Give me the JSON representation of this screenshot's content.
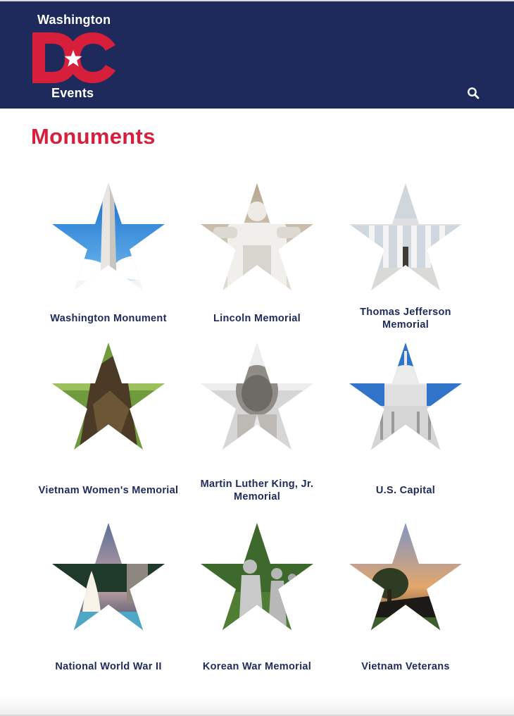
{
  "header": {
    "logo": {
      "top_text": "Washington",
      "mark_text": "DC",
      "bottom_text": "Events"
    },
    "search_icon": "search-icon"
  },
  "page": {
    "title": "Monuments"
  },
  "monuments": [
    {
      "label": "Washington Monument",
      "photo": "obelisk against blue sky"
    },
    {
      "label": "Lincoln Memorial",
      "photo": "seated marble statue"
    },
    {
      "label": "Thomas Jefferson Memorial",
      "photo": "domed colonnade"
    },
    {
      "label": "Vietnam Women's Memorial",
      "photo": "bronze statue group on grass"
    },
    {
      "label": "Martin Luther King, Jr. Memorial",
      "photo": "granite carved face"
    },
    {
      "label": "U.S. Capital",
      "photo": "capitol dome"
    },
    {
      "label": "National World War II",
      "photo": "fountains at dusk"
    },
    {
      "label": "Korean War Memorial",
      "photo": "soldier statues in field"
    },
    {
      "label": "Vietnam Veterans",
      "photo": "dark wall at sunset"
    }
  ],
  "colors": {
    "header_bg": "#1f2a5c",
    "brand_red": "#d71f3c",
    "label_navy": "#1f2a5c"
  }
}
